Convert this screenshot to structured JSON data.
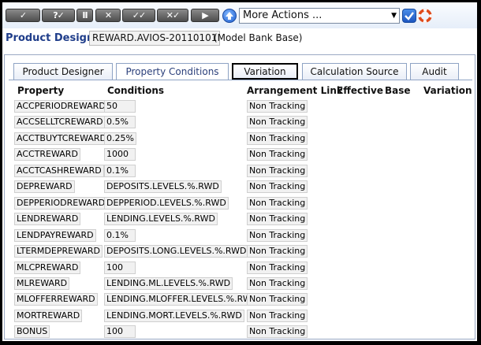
{
  "toolbar": {
    "buttons": [
      {
        "name": "commit-button",
        "label": "✓"
      },
      {
        "name": "validate-button",
        "label": "?✓"
      },
      {
        "name": "hold-button",
        "label": "II"
      },
      {
        "name": "delete-button",
        "label": "✕"
      },
      {
        "name": "authorise-button",
        "label": "✓✓"
      },
      {
        "name": "reverse-button",
        "label": "✕✓"
      },
      {
        "name": "next-button",
        "label": "▶"
      }
    ],
    "more_actions": "More Actions ...",
    "icons": [
      "upload-icon",
      "check-icon",
      "help-ring-icon"
    ]
  },
  "header": {
    "title": "Product Designer",
    "record_id": "REWARD.AVIOS-20110101",
    "description": "(Model Bank Base)"
  },
  "tabs": [
    {
      "label": "Product Designer",
      "state": "normal"
    },
    {
      "label": "Property Conditions",
      "state": "active"
    },
    {
      "label": "Variation",
      "state": "focused"
    },
    {
      "label": "Calculation Source",
      "state": "normal"
    },
    {
      "label": "Audit",
      "state": "normal"
    }
  ],
  "columns": {
    "property": "Property",
    "conditions": "Conditions",
    "arrangement_link": "Arrangement Link",
    "effective": "Effective",
    "base": "Base",
    "variation": "Variation"
  },
  "rows": [
    {
      "property": "ACCPERIODREWARD",
      "condition": "50",
      "arrangement": "Non Tracking"
    },
    {
      "property": "ACCSELLTCREWARD",
      "condition": "0.5%",
      "arrangement": "Non Tracking"
    },
    {
      "property": "ACCTBUYTCREWARD",
      "condition": "0.25%",
      "arrangement": "Non Tracking"
    },
    {
      "property": "ACCTREWARD",
      "condition": "1000",
      "arrangement": "Non Tracking"
    },
    {
      "property": "ACCTCASHREWARD",
      "condition": "0.1%",
      "arrangement": "Non Tracking"
    },
    {
      "property": "DEPREWARD",
      "condition": "DEPOSITS.LEVELS.%.RWD",
      "arrangement": "Non Tracking"
    },
    {
      "property": "DEPPERIODREWARD",
      "condition": "DEPPERIOD.LEVELS.%.RWD",
      "arrangement": "Non Tracking"
    },
    {
      "property": "LENDREWARD",
      "condition": "LENDING.LEVELS.%.RWD",
      "arrangement": "Non Tracking"
    },
    {
      "property": "LENDPAYREWARD",
      "condition": "0.1%",
      "arrangement": "Non Tracking"
    },
    {
      "property": "LTERMDEPREWARD",
      "condition": "DEPOSITS.LONG.LEVELS.%.RWD",
      "arrangement": "Non Tracking"
    },
    {
      "property": "MLCPREWARD",
      "condition": "100",
      "arrangement": "Non Tracking"
    },
    {
      "property": "MLREWARD",
      "condition": "LENDING.ML.LEVELS.%.RWD",
      "arrangement": "Non Tracking"
    },
    {
      "property": "MLOFFERREWARD",
      "condition": "LENDING.MLOFFER.LEVELS.%.RWD",
      "arrangement": "Non Tracking"
    },
    {
      "property": "MORTREWARD",
      "condition": "LENDING.MORT.LEVELS.%.RWD",
      "arrangement": "Non Tracking"
    },
    {
      "property": "BONUS",
      "condition": "100",
      "arrangement": "Non Tracking"
    }
  ]
}
